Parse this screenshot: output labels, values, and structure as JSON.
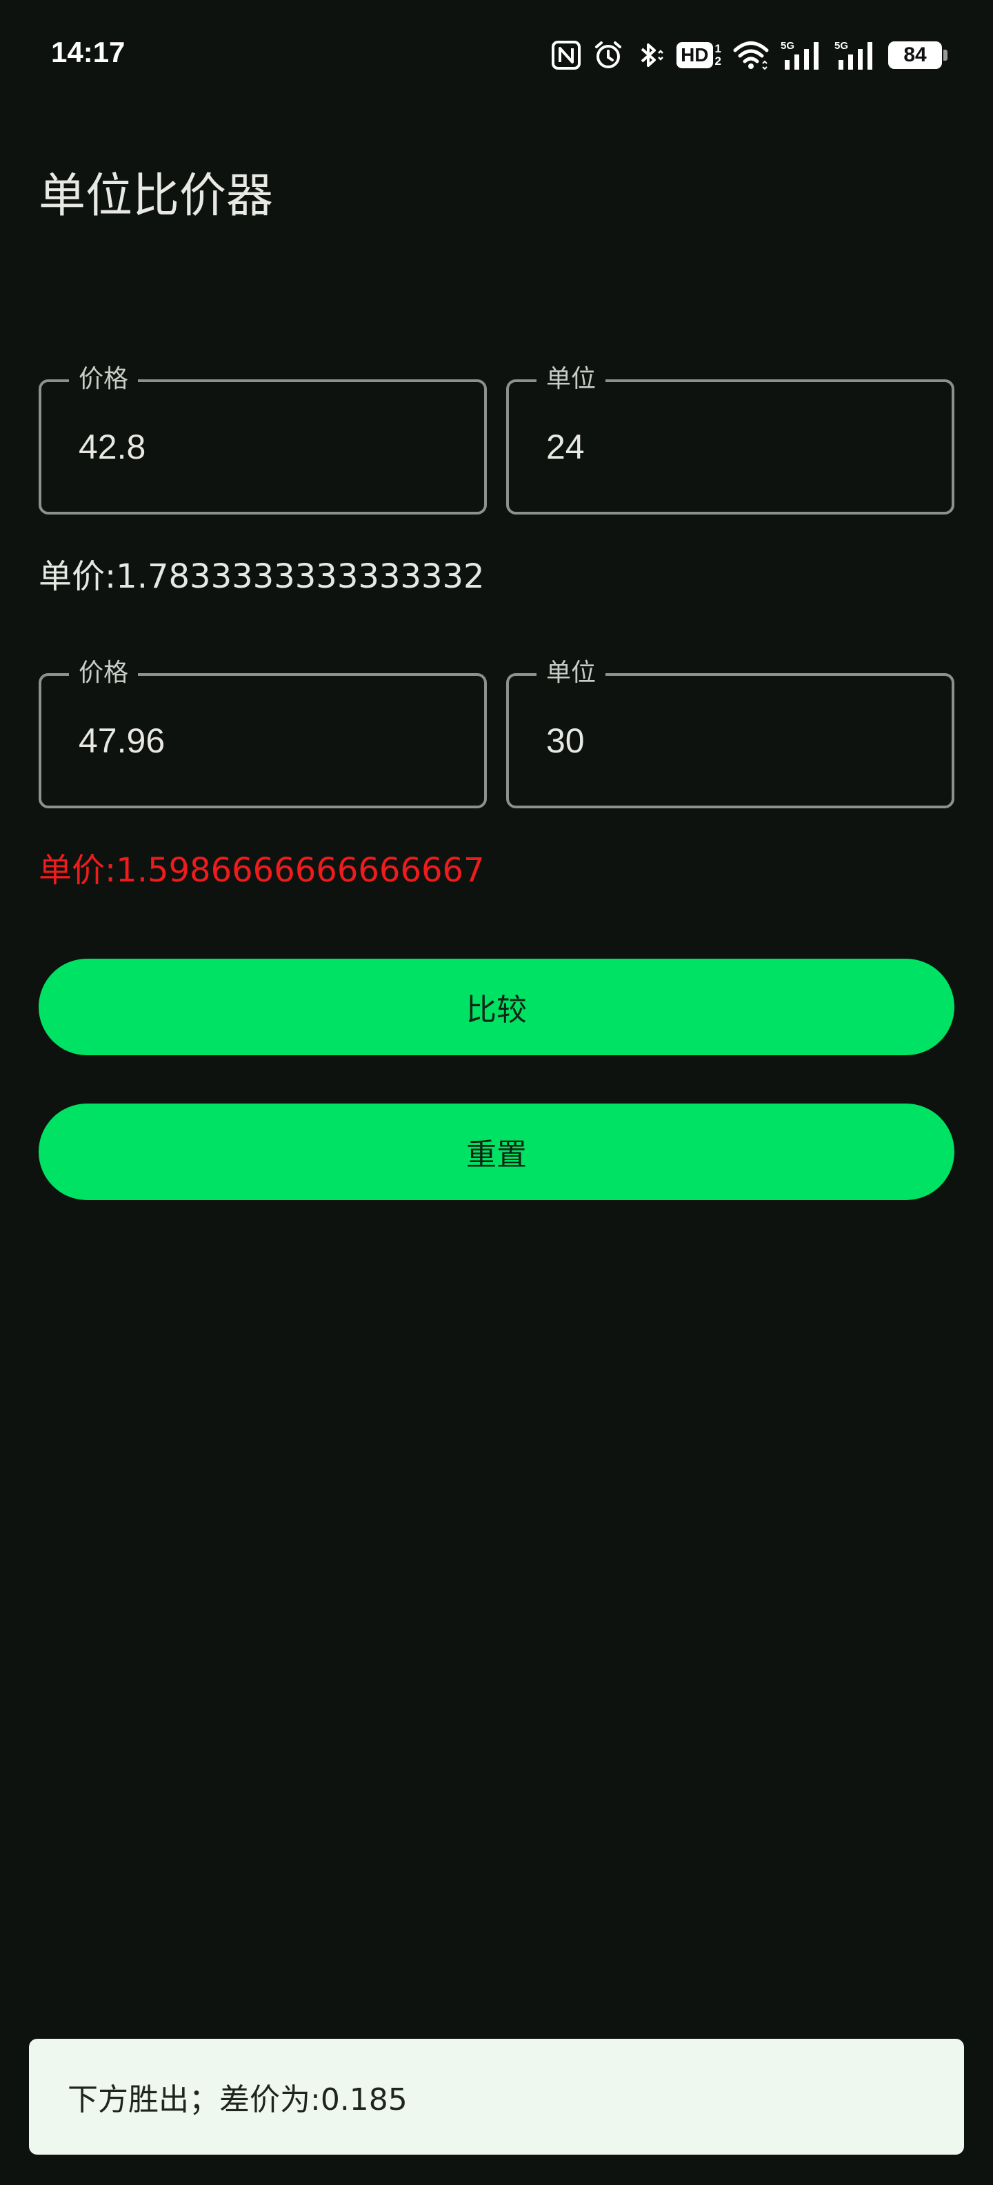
{
  "status_bar": {
    "time": "14:17",
    "battery": "84",
    "hd_sup": "1",
    "hd_sub": "2",
    "icons": [
      "nfc-icon",
      "alarm-icon",
      "bluetooth-icon",
      "hd-icon",
      "wifi-icon",
      "signal-5g-icon",
      "signal-5g-icon"
    ]
  },
  "app": {
    "title": "单位比价器"
  },
  "item1": {
    "price_label": "价格",
    "price_value": "42.8",
    "unit_label": "单位",
    "unit_value": "24",
    "unit_price": "单价:1.7833333333333332"
  },
  "item2": {
    "price_label": "价格",
    "price_value": "47.96",
    "unit_label": "单位",
    "unit_value": "30",
    "unit_price": "单价:1.5986666666666667"
  },
  "buttons": {
    "compare": "比较",
    "reset": "重置"
  },
  "snackbar": {
    "message": "下方胜出；差价为:0.185"
  },
  "colors": {
    "background": "#0e120e",
    "accent": "#00e263",
    "winner": "#ee1c1c",
    "snackbar_bg": "#eff8ee"
  }
}
